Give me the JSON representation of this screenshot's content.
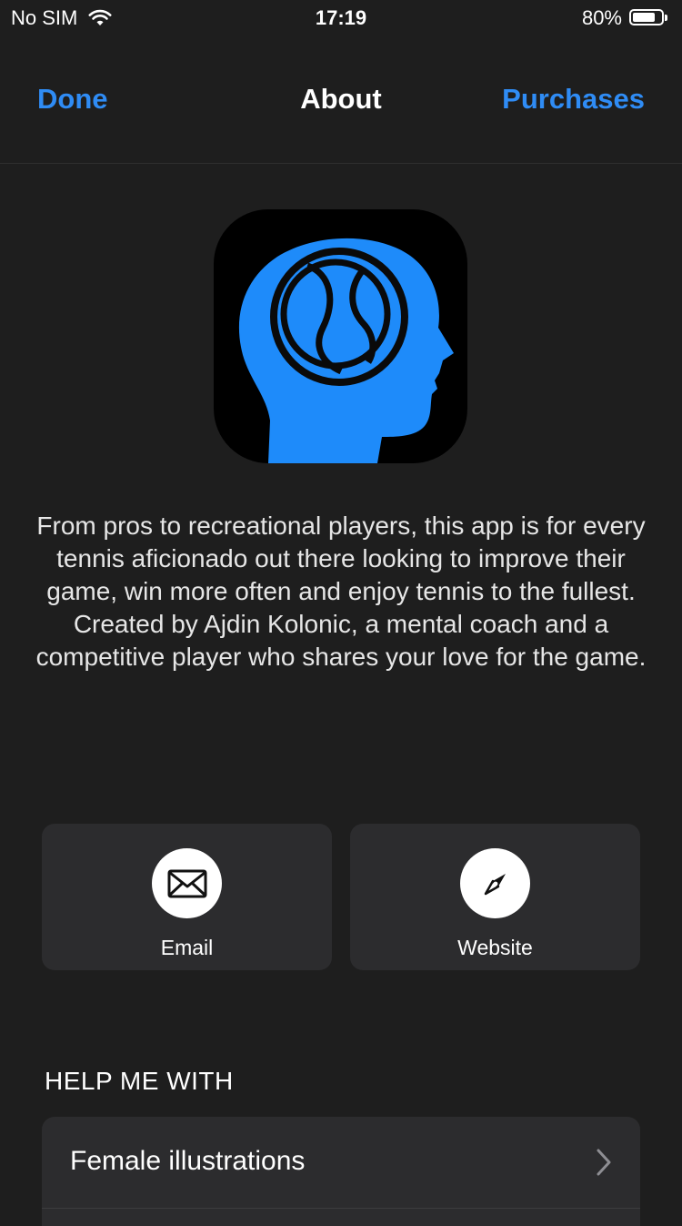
{
  "status_bar": {
    "carrier": "No SIM",
    "time": "17:19",
    "battery_percent_label": "80%",
    "battery_level": 0.8
  },
  "nav": {
    "left_label": "Done",
    "title": "About",
    "right_label": "Purchases",
    "accent_color": "#2f8cf5"
  },
  "app_icon": {
    "icon": "brain-tennis-head-icon",
    "color": "#1e8bfa"
  },
  "description": "From pros to recreational players, this app is for every tennis aficionado out there looking to improve their game, win more often and enjoy tennis to the fullest. Created by Ajdin Kolonic, a mental coach and a competitive player who shares your love for the game.",
  "actions": [
    {
      "label": "Email",
      "icon": "envelope-icon"
    },
    {
      "label": "Website",
      "icon": "compass-icon"
    }
  ],
  "help_section": {
    "header": "HELP ME WITH",
    "items": [
      {
        "label": "Female illustrations",
        "icon": "chevron-right-icon"
      }
    ]
  }
}
